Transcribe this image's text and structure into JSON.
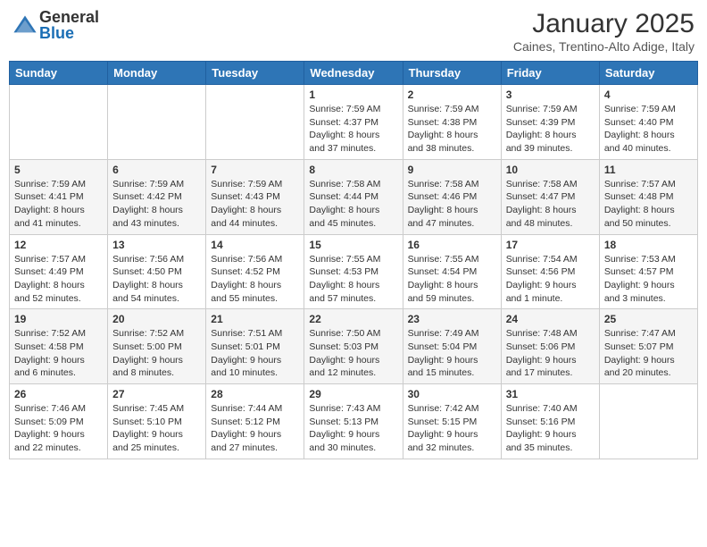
{
  "header": {
    "logo": {
      "general": "General",
      "blue": "Blue"
    },
    "title": "January 2025",
    "location": "Caines, Trentino-Alto Adige, Italy"
  },
  "days_of_week": [
    "Sunday",
    "Monday",
    "Tuesday",
    "Wednesday",
    "Thursday",
    "Friday",
    "Saturday"
  ],
  "weeks": [
    [
      {
        "day": "",
        "info": ""
      },
      {
        "day": "",
        "info": ""
      },
      {
        "day": "",
        "info": ""
      },
      {
        "day": "1",
        "info": "Sunrise: 7:59 AM\nSunset: 4:37 PM\nDaylight: 8 hours and 37 minutes."
      },
      {
        "day": "2",
        "info": "Sunrise: 7:59 AM\nSunset: 4:38 PM\nDaylight: 8 hours and 38 minutes."
      },
      {
        "day": "3",
        "info": "Sunrise: 7:59 AM\nSunset: 4:39 PM\nDaylight: 8 hours and 39 minutes."
      },
      {
        "day": "4",
        "info": "Sunrise: 7:59 AM\nSunset: 4:40 PM\nDaylight: 8 hours and 40 minutes."
      }
    ],
    [
      {
        "day": "5",
        "info": "Sunrise: 7:59 AM\nSunset: 4:41 PM\nDaylight: 8 hours and 41 minutes."
      },
      {
        "day": "6",
        "info": "Sunrise: 7:59 AM\nSunset: 4:42 PM\nDaylight: 8 hours and 43 minutes."
      },
      {
        "day": "7",
        "info": "Sunrise: 7:59 AM\nSunset: 4:43 PM\nDaylight: 8 hours and 44 minutes."
      },
      {
        "day": "8",
        "info": "Sunrise: 7:58 AM\nSunset: 4:44 PM\nDaylight: 8 hours and 45 minutes."
      },
      {
        "day": "9",
        "info": "Sunrise: 7:58 AM\nSunset: 4:46 PM\nDaylight: 8 hours and 47 minutes."
      },
      {
        "day": "10",
        "info": "Sunrise: 7:58 AM\nSunset: 4:47 PM\nDaylight: 8 hours and 48 minutes."
      },
      {
        "day": "11",
        "info": "Sunrise: 7:57 AM\nSunset: 4:48 PM\nDaylight: 8 hours and 50 minutes."
      }
    ],
    [
      {
        "day": "12",
        "info": "Sunrise: 7:57 AM\nSunset: 4:49 PM\nDaylight: 8 hours and 52 minutes."
      },
      {
        "day": "13",
        "info": "Sunrise: 7:56 AM\nSunset: 4:50 PM\nDaylight: 8 hours and 54 minutes."
      },
      {
        "day": "14",
        "info": "Sunrise: 7:56 AM\nSunset: 4:52 PM\nDaylight: 8 hours and 55 minutes."
      },
      {
        "day": "15",
        "info": "Sunrise: 7:55 AM\nSunset: 4:53 PM\nDaylight: 8 hours and 57 minutes."
      },
      {
        "day": "16",
        "info": "Sunrise: 7:55 AM\nSunset: 4:54 PM\nDaylight: 8 hours and 59 minutes."
      },
      {
        "day": "17",
        "info": "Sunrise: 7:54 AM\nSunset: 4:56 PM\nDaylight: 9 hours and 1 minute."
      },
      {
        "day": "18",
        "info": "Sunrise: 7:53 AM\nSunset: 4:57 PM\nDaylight: 9 hours and 3 minutes."
      }
    ],
    [
      {
        "day": "19",
        "info": "Sunrise: 7:52 AM\nSunset: 4:58 PM\nDaylight: 9 hours and 6 minutes."
      },
      {
        "day": "20",
        "info": "Sunrise: 7:52 AM\nSunset: 5:00 PM\nDaylight: 9 hours and 8 minutes."
      },
      {
        "day": "21",
        "info": "Sunrise: 7:51 AM\nSunset: 5:01 PM\nDaylight: 9 hours and 10 minutes."
      },
      {
        "day": "22",
        "info": "Sunrise: 7:50 AM\nSunset: 5:03 PM\nDaylight: 9 hours and 12 minutes."
      },
      {
        "day": "23",
        "info": "Sunrise: 7:49 AM\nSunset: 5:04 PM\nDaylight: 9 hours and 15 minutes."
      },
      {
        "day": "24",
        "info": "Sunrise: 7:48 AM\nSunset: 5:06 PM\nDaylight: 9 hours and 17 minutes."
      },
      {
        "day": "25",
        "info": "Sunrise: 7:47 AM\nSunset: 5:07 PM\nDaylight: 9 hours and 20 minutes."
      }
    ],
    [
      {
        "day": "26",
        "info": "Sunrise: 7:46 AM\nSunset: 5:09 PM\nDaylight: 9 hours and 22 minutes."
      },
      {
        "day": "27",
        "info": "Sunrise: 7:45 AM\nSunset: 5:10 PM\nDaylight: 9 hours and 25 minutes."
      },
      {
        "day": "28",
        "info": "Sunrise: 7:44 AM\nSunset: 5:12 PM\nDaylight: 9 hours and 27 minutes."
      },
      {
        "day": "29",
        "info": "Sunrise: 7:43 AM\nSunset: 5:13 PM\nDaylight: 9 hours and 30 minutes."
      },
      {
        "day": "30",
        "info": "Sunrise: 7:42 AM\nSunset: 5:15 PM\nDaylight: 9 hours and 32 minutes."
      },
      {
        "day": "31",
        "info": "Sunrise: 7:40 AM\nSunset: 5:16 PM\nDaylight: 9 hours and 35 minutes."
      },
      {
        "day": "",
        "info": ""
      }
    ]
  ]
}
